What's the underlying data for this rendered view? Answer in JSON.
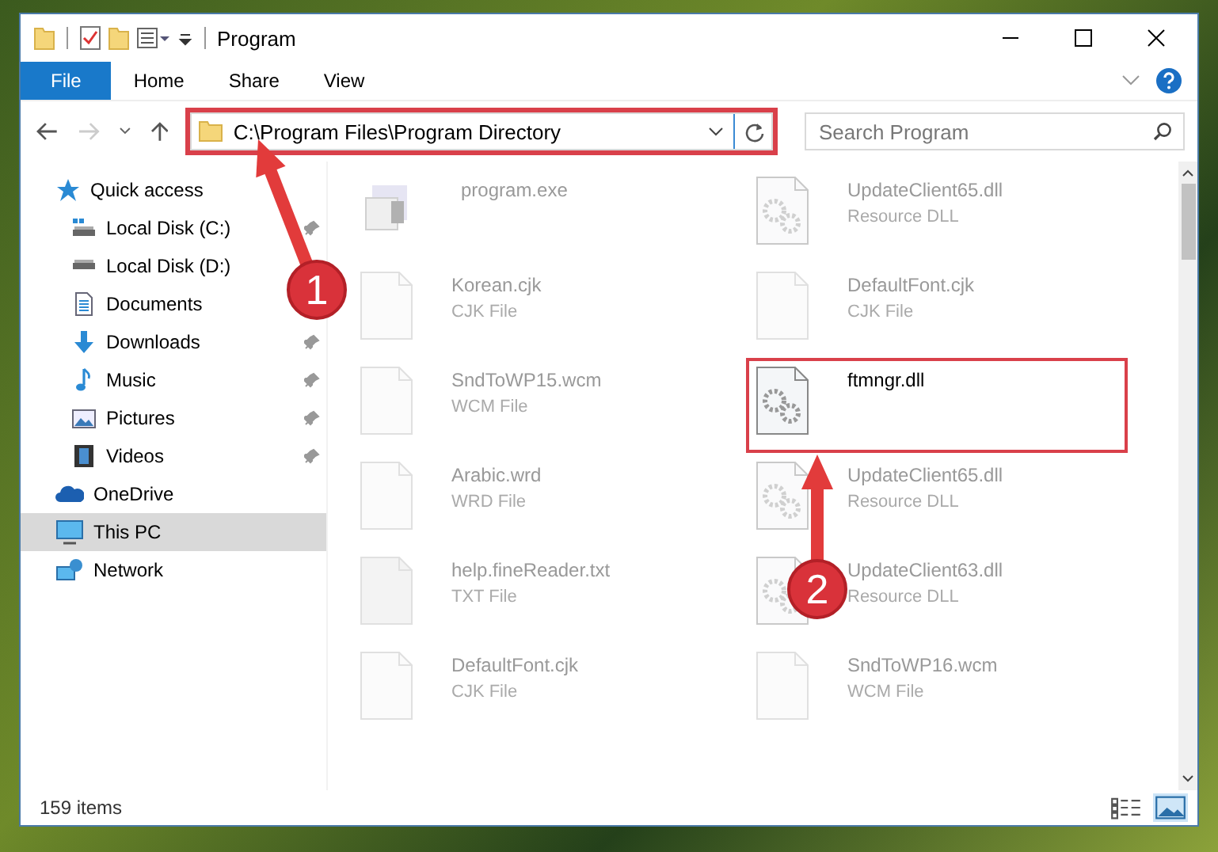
{
  "window": {
    "title": "Program"
  },
  "ribbon_tabs": [
    {
      "label": "File",
      "kind": "file"
    },
    {
      "label": "Home",
      "kind": "tab"
    },
    {
      "label": "Share",
      "kind": "tab"
    },
    {
      "label": "View",
      "kind": "tab"
    }
  ],
  "navigation": {
    "forward_disabled": true
  },
  "address_bar": {
    "path": "C:\\Program Files\\Program Directory",
    "highlighted": true
  },
  "search": {
    "placeholder": "Search Program"
  },
  "sidebar": {
    "items": [
      {
        "label": "Quick access",
        "kind": "star",
        "selected": false,
        "children": [
          {
            "label": "Local Disk (C:)",
            "kind": "system-drive",
            "pinned": true
          },
          {
            "label": "Local Disk (D:)",
            "kind": "drive",
            "pinned": false
          },
          {
            "label": "Documents",
            "kind": "document",
            "pinned": false
          },
          {
            "label": "Downloads",
            "kind": "download",
            "pinned": true
          },
          {
            "label": "Music",
            "kind": "music",
            "pinned": true
          },
          {
            "label": "Pictures",
            "kind": "picture",
            "pinned": true
          },
          {
            "label": "Videos",
            "kind": "video",
            "pinned": true
          }
        ]
      },
      {
        "label": "OneDrive",
        "kind": "cloud",
        "selected": false
      },
      {
        "label": "This PC",
        "kind": "pc",
        "selected": true
      },
      {
        "label": "Network",
        "kind": "network",
        "selected": false
      }
    ]
  },
  "files": [
    {
      "name": "program.exe",
      "kind": "exe",
      "highlighted": false
    },
    {
      "name": "UpdateClient65.dll",
      "type": "Resource DLL",
      "kind": "dll",
      "highlighted": false
    },
    {
      "name": "Korean.cjk",
      "type": "CJK File",
      "kind": "doc",
      "highlighted": false
    },
    {
      "name": "DefaultFont.cjk",
      "type": "CJK File",
      "kind": "doc",
      "highlighted": false
    },
    {
      "name": "SndToWP15.wcm",
      "type": "WCM File",
      "kind": "doc",
      "highlighted": false
    },
    {
      "name": "ftmngr.dll",
      "kind": "dll",
      "highlighted": true
    },
    {
      "name": "Arabic.wrd",
      "type": "WRD File",
      "kind": "doc",
      "highlighted": false
    },
    {
      "name": "UpdateClient65.dll",
      "type": "Resource DLL",
      "kind": "dll",
      "highlighted": false
    },
    {
      "name": "help.fineReader.txt",
      "type": "TXT File",
      "kind": "txt",
      "highlighted": false
    },
    {
      "name": "UpdateClient63.dll",
      "type": "Resource DLL",
      "kind": "dll",
      "highlighted": false
    },
    {
      "name": "DefaultFont.cjk",
      "type": "CJK File",
      "kind": "doc",
      "highlighted": false
    },
    {
      "name": "SndToWP16.wcm",
      "type": "WCM File",
      "kind": "doc",
      "highlighted": false
    }
  ],
  "status_bar": {
    "item_count": "159 items",
    "views": [
      {
        "kind": "details",
        "selected": false
      },
      {
        "kind": "large-icons",
        "selected": true
      }
    ]
  },
  "annotations": [
    {
      "number": "1"
    },
    {
      "number": "2"
    }
  ]
}
